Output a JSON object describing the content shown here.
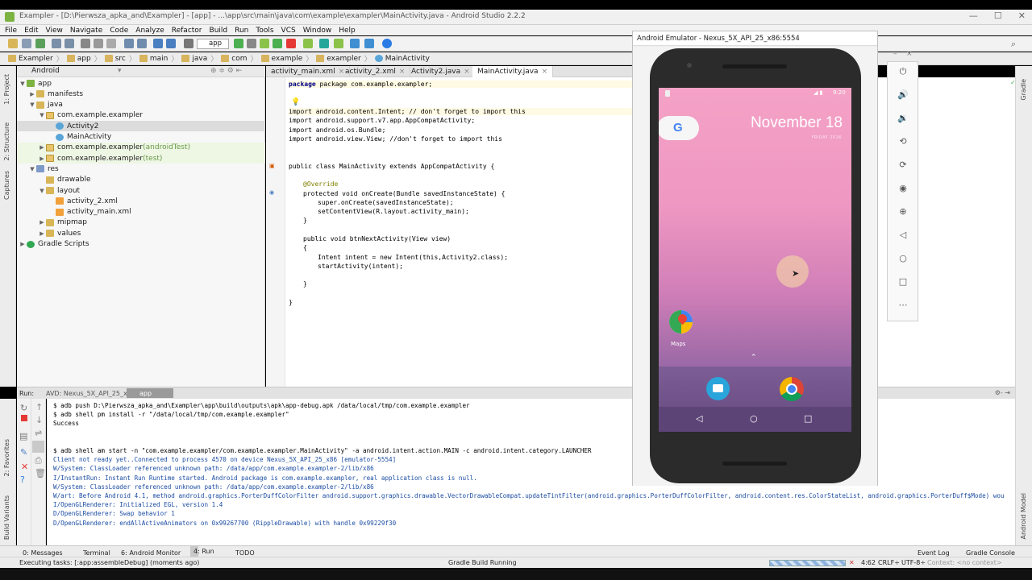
{
  "window": {
    "title": "Exampler - [D:\\Pierwsza_apka_and\\Exampler] - [app] - ...\\app\\src\\main\\java\\com\\example\\exampler\\MainActivity.java - Android Studio 2.2.2",
    "min": "—",
    "max": "☐",
    "close": "✕"
  },
  "menu": [
    "File",
    "Edit",
    "View",
    "Navigate",
    "Code",
    "Analyze",
    "Refactor",
    "Build",
    "Run",
    "Tools",
    "VCS",
    "Window",
    "Help"
  ],
  "toolbar": {
    "run_config": "app"
  },
  "breadcrumbs": [
    "Exampler",
    "app",
    "src",
    "main",
    "java",
    "com",
    "example",
    "exampler",
    "MainActivity"
  ],
  "project_panel": {
    "view_selector": "Android",
    "tree": [
      {
        "label": "app",
        "depth": 0,
        "arrow": "▼",
        "icon": "app"
      },
      {
        "label": "manifests",
        "depth": 1,
        "arrow": "▶",
        "icon": "folder"
      },
      {
        "label": "java",
        "depth": 1,
        "arrow": "▼",
        "icon": "folder"
      },
      {
        "label": "com.example.exampler",
        "depth": 2,
        "arrow": "▼",
        "icon": "pkg"
      },
      {
        "label": "Activity2",
        "depth": 3,
        "arrow": "",
        "icon": "cls",
        "selected": true
      },
      {
        "label": "MainActivity",
        "depth": 3,
        "arrow": "",
        "icon": "cls"
      },
      {
        "label": "com.example.exampler",
        "suffix": "(androidTest)",
        "depth": 2,
        "arrow": "▶",
        "icon": "pkg",
        "tint": true
      },
      {
        "label": "com.example.exampler",
        "suffix": "(test)",
        "depth": 2,
        "arrow": "▶",
        "icon": "pkg",
        "tint": true
      },
      {
        "label": "res",
        "depth": 1,
        "arrow": "▼",
        "icon": "res"
      },
      {
        "label": "drawable",
        "depth": 2,
        "arrow": "",
        "icon": "folder"
      },
      {
        "label": "layout",
        "depth": 2,
        "arrow": "▼",
        "icon": "folder"
      },
      {
        "label": "activity_2.xml",
        "depth": 3,
        "arrow": "",
        "icon": "xml"
      },
      {
        "label": "activity_main.xml",
        "depth": 3,
        "arrow": "",
        "icon": "xml"
      },
      {
        "label": "mipmap",
        "depth": 2,
        "arrow": "▶",
        "icon": "folder"
      },
      {
        "label": "values",
        "depth": 2,
        "arrow": "▶",
        "icon": "folder"
      },
      {
        "label": "Gradle Scripts",
        "depth": 0,
        "arrow": "▶",
        "icon": "gradle"
      }
    ]
  },
  "editor_tabs": [
    {
      "label": "activity_main.xml",
      "active": false
    },
    {
      "label": "activity_2.xml",
      "active": false
    },
    {
      "label": "Activity2.java",
      "active": false
    },
    {
      "label": "MainActivity.java",
      "active": true
    }
  ],
  "code_lines": [
    "package com.example.exampler;",
    "import android.content.Intent; // don't forget to import this",
    "import android.support.v7.app.AppCompatActivity;",
    "import android.os.Bundle;",
    "import android.view.View; //don't forget to import this",
    "public class MainActivity extends AppCompatActivity {",
    "@Override",
    "protected void onCreate(Bundle savedInstanceState) {",
    "super.onCreate(savedInstanceState);",
    "setContentView(R.layout.activity_main);",
    "}",
    "public void btnNextActivity(View view)",
    "{",
    "Intent intent = new Intent(this,Activity2.class);",
    "startActivity(intent);",
    "}",
    "}"
  ],
  "run_panel": {
    "label": "Run:",
    "tabs": [
      "AVD: Nexus_5X_API_25_x86",
      "app"
    ],
    "console": [
      "$ adb push D:\\Pierwsza_apka_and\\Exampler\\app\\build\\outputs\\apk\\app-debug.apk /data/local/tmp/com.example.exampler",
      "$ adb shell pm install -r \"/data/local/tmp/com.example.exampler\"",
      "Success",
      "",
      "",
      "$ adb shell am start -n \"com.example.exampler/com.example.exampler.MainActivity\" -a android.intent.action.MAIN -c android.intent.category.LAUNCHER",
      "Client not ready yet..Connected to process 4570 on device Nexus_5X_API_25_x86 [emulator-5554]",
      "W/System: ClassLoader referenced unknown path: /data/app/com.example.exampler-2/lib/x86",
      "I/InstantRun: Instant Run Runtime started. Android package is com.example.exampler, real application class is null.",
      "W/System: ClassLoader referenced unknown path: /data/app/com.example.exampler-2/lib/x86",
      "W/art: Before Android 4.1, method android.graphics.PorterDuffColorFilter android.support.graphics.drawable.VectorDrawableCompat.updateTintFilter(android.graphics.PorterDuffColorFilter, android.content.res.ColorStateList, android.graphics.PorterDuff$Mode) wou",
      "I/OpenGLRenderer: Initialized EGL, version 1.4",
      "D/OpenGLRenderer: Swap behavior 1",
      "D/OpenGLRenderer: endAllActiveAnimators on 0x99267700 (RippleDrawable) with handle 0x99229f30"
    ]
  },
  "tool_strip": {
    "messages": "0: Messages",
    "terminal": "Terminal",
    "monitor": "6: Android Monitor",
    "run": "4: Run",
    "todo": "TODO",
    "event_log": "Event Log",
    "gradle_console": "Gradle Console"
  },
  "status": {
    "left": "Executing tasks: [:app:assembleDebug] (moments ago)",
    "center": "Gradle Build Running",
    "position": "4:62",
    "line_sep": "CRLF÷",
    "encoding": "UTF-8÷",
    "context": "Context: <no context>"
  },
  "side_tabs": {
    "left_top": [
      "1: Project",
      "2: Structure",
      "Captures"
    ],
    "left_bottom": [
      "2: Favorites",
      "Build Variants"
    ],
    "right": [
      "Gradle",
      "Android Model"
    ]
  },
  "emulator": {
    "title": "Android Emulator - Nexus_5X_API_25_x86:5554",
    "time": "9:20",
    "date": "November 18",
    "date_sub": "FRIDAY 2016",
    "google_letter": "G",
    "maps_label": "Maps"
  },
  "colors": {
    "accent": "#3875d7",
    "wallpaper_top": "#f5a2c6",
    "wallpaper_bottom": "#7a5a92"
  }
}
